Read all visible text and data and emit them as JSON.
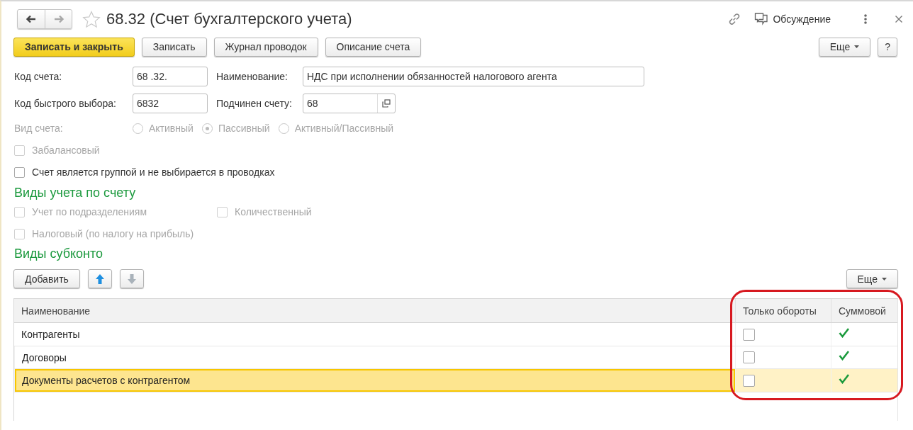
{
  "nav_buttons": [
    {
      "kind": "back",
      "disabled": false
    },
    {
      "kind": "forward",
      "disabled": true
    }
  ],
  "favorite": false,
  "title": "68.32 (Счет бухгалтерского учета)",
  "discussion": "Обсуждение",
  "toolbar": {
    "buttons": [
      {
        "label": "Записать и закрыть",
        "kind": "default"
      },
      {
        "label": "Записать",
        "kind": "normal"
      },
      {
        "label": "Журнал проводок",
        "kind": "normal"
      },
      {
        "label": "Описание счета",
        "kind": "normal"
      }
    ],
    "more": "Еще",
    "help": "?"
  },
  "field_rows": [
    [
      {
        "label": "Код счета:",
        "value": "68 .32.",
        "kind": "text"
      },
      {
        "label": "Наименование:",
        "value": "НДС при исполнении обязанностей налогового агента",
        "kind": "text"
      }
    ],
    [
      {
        "label": "Код быстрого выбора:",
        "value": "6832",
        "kind": "text"
      },
      {
        "label": "Подчинен счету:",
        "value": "68",
        "kind": "choice"
      }
    ]
  ],
  "account_type": {
    "label": "Вид счета:",
    "disabled": true,
    "options": [
      {
        "label": "Активный",
        "selected": false
      },
      {
        "label": "Пассивный",
        "selected": true
      },
      {
        "label": "Активный/Пассивный",
        "selected": false
      }
    ]
  },
  "checkboxes": [
    {
      "label": "Забалансовый",
      "checked": false,
      "disabled": true
    },
    {
      "label": "Счет является группой и не выбирается в проводках",
      "checked": false,
      "disabled": false
    }
  ],
  "accounting_section": {
    "title": "Виды учета по счету",
    "rows": [
      [
        {
          "label": "Учет по подразделениям",
          "checked": false,
          "disabled": true
        },
        {
          "label": "Количественный",
          "checked": false,
          "disabled": true
        }
      ],
      [
        {
          "label": "Налоговый (по налогу на прибыль)",
          "checked": false,
          "disabled": true
        }
      ]
    ]
  },
  "subconto_section": {
    "title": "Виды субконто",
    "buttons": [
      {
        "kind": "text",
        "label": "Добавить",
        "disabled": false
      },
      {
        "kind": "up",
        "disabled": false
      },
      {
        "kind": "down",
        "disabled": true
      }
    ],
    "more": "Еще",
    "table": {
      "columns": [
        {
          "title": "Наименование",
          "kind": "text",
          "highlighted": false
        },
        {
          "title": "Только обороты",
          "kind": "checkbox",
          "highlighted": true
        },
        {
          "title": "Суммовой",
          "kind": "checkmark",
          "highlighted": true
        }
      ],
      "rows": [
        {
          "selected": false,
          "cells": [
            {
              "text": "Контрагенты"
            },
            {
              "checked": false
            },
            {
              "checked": true
            }
          ]
        },
        {
          "selected": false,
          "cells": [
            {
              "text": "Договоры"
            },
            {
              "checked": false
            },
            {
              "checked": true
            }
          ]
        },
        {
          "selected": true,
          "cells": [
            {
              "text": "Документы расчетов с контрагентом"
            },
            {
              "checked": false
            },
            {
              "checked": true
            }
          ]
        }
      ]
    }
  }
}
